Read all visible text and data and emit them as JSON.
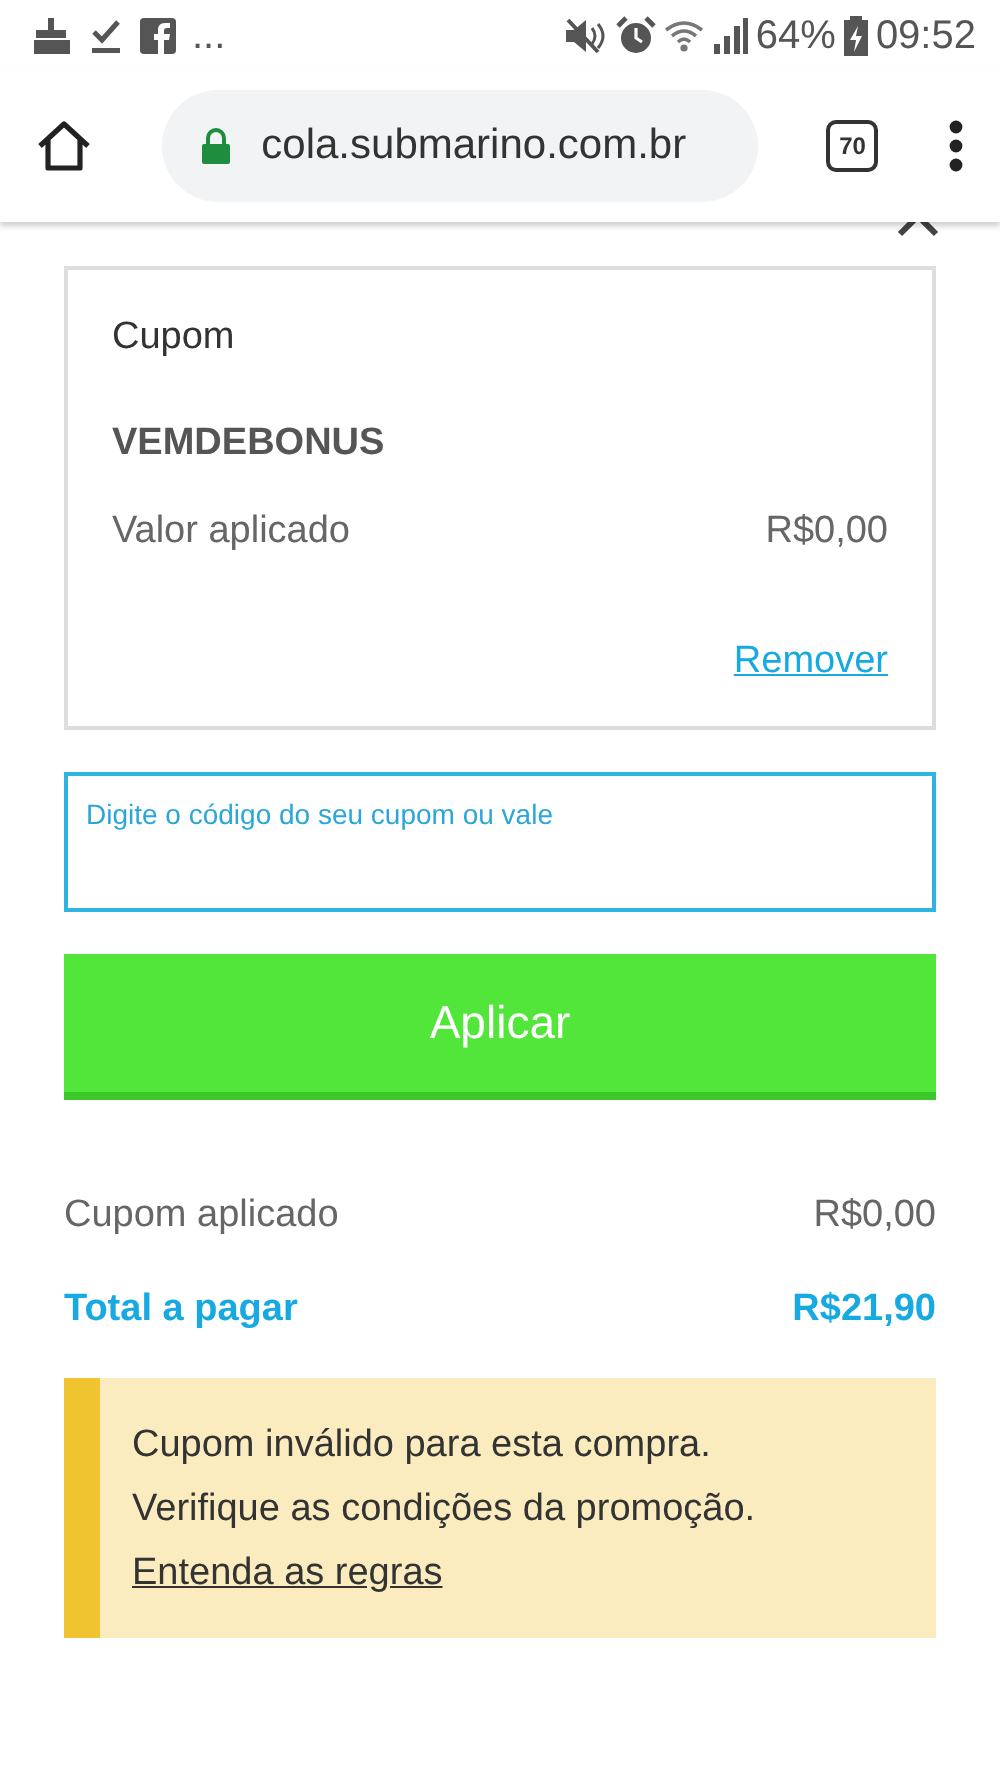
{
  "status_bar": {
    "more": "...",
    "battery": "64%",
    "time": "09:52"
  },
  "browser": {
    "url": "cola.submarino.com.br",
    "tab_count": "70"
  },
  "coupon_card": {
    "heading": "Cupom",
    "code": "VEMDEBONUS",
    "label": "Valor aplicado",
    "value": "R$0,00",
    "remove_link": "Remover"
  },
  "code_field": {
    "placeholder": "Digite o código do seu cupom ou vale"
  },
  "apply_button": "Aplicar",
  "summary": [
    {
      "label": "Cupom aplicado",
      "value": "R$0,00",
      "kind": "normal"
    },
    {
      "label": "Total a pagar",
      "value": "R$21,90",
      "kind": "total"
    }
  ],
  "alert": {
    "lines": [
      "Cupom inválido para esta compra.",
      "Verifique as condições da promoção."
    ],
    "link": "Entenda as regras"
  }
}
